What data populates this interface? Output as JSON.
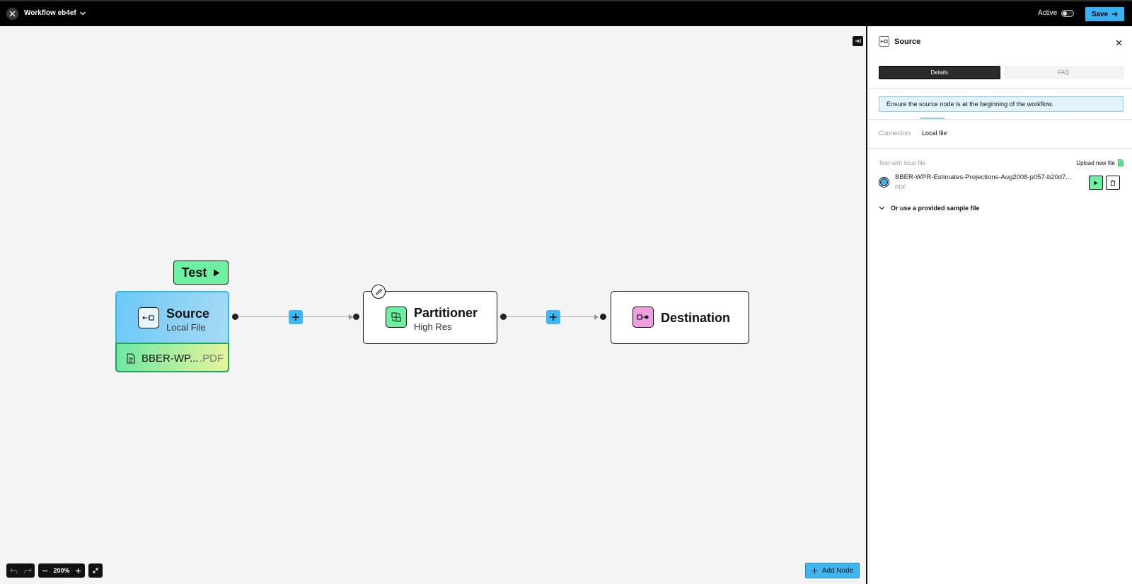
{
  "topbar": {
    "workflow_title": "Workflow eb4ef",
    "active_label": "Active",
    "save_label": "Save"
  },
  "canvas": {
    "test_button_label": "Test",
    "source_node": {
      "title": "Source",
      "subtitle": "Local File",
      "file_name": "BBER-WP...",
      "file_ext": ".PDF"
    },
    "partitioner_node": {
      "title": "Partitioner",
      "subtitle": "High Res"
    },
    "destination_node": {
      "title": "Destination"
    },
    "zoom_level": "200%",
    "add_node_label": "Add Node"
  },
  "panel": {
    "title": "Source",
    "tabs": [
      {
        "label": "Details",
        "active": true
      },
      {
        "label": "FAQ",
        "active": false
      }
    ],
    "notice": "Ensure the source node is at the beginning of the workflow.",
    "subtabs": [
      {
        "label": "Connectors",
        "active": false
      },
      {
        "label": "Local file",
        "active": true
      }
    ],
    "test_local_label": "Test with local file",
    "upload_label": "Upload new file",
    "file": {
      "name": "BBER-WPR-Estimates-Projections-Aug2008-p057-b20d7...",
      "type": "PDF"
    },
    "sample_toggle_label": "Or use a provided sample file"
  },
  "colors": {
    "accent_blue": "#3fb6f2",
    "accent_green": "#6ef0a1",
    "destination_pink": "#ee9fe0",
    "topbar_bg": "#000000"
  }
}
